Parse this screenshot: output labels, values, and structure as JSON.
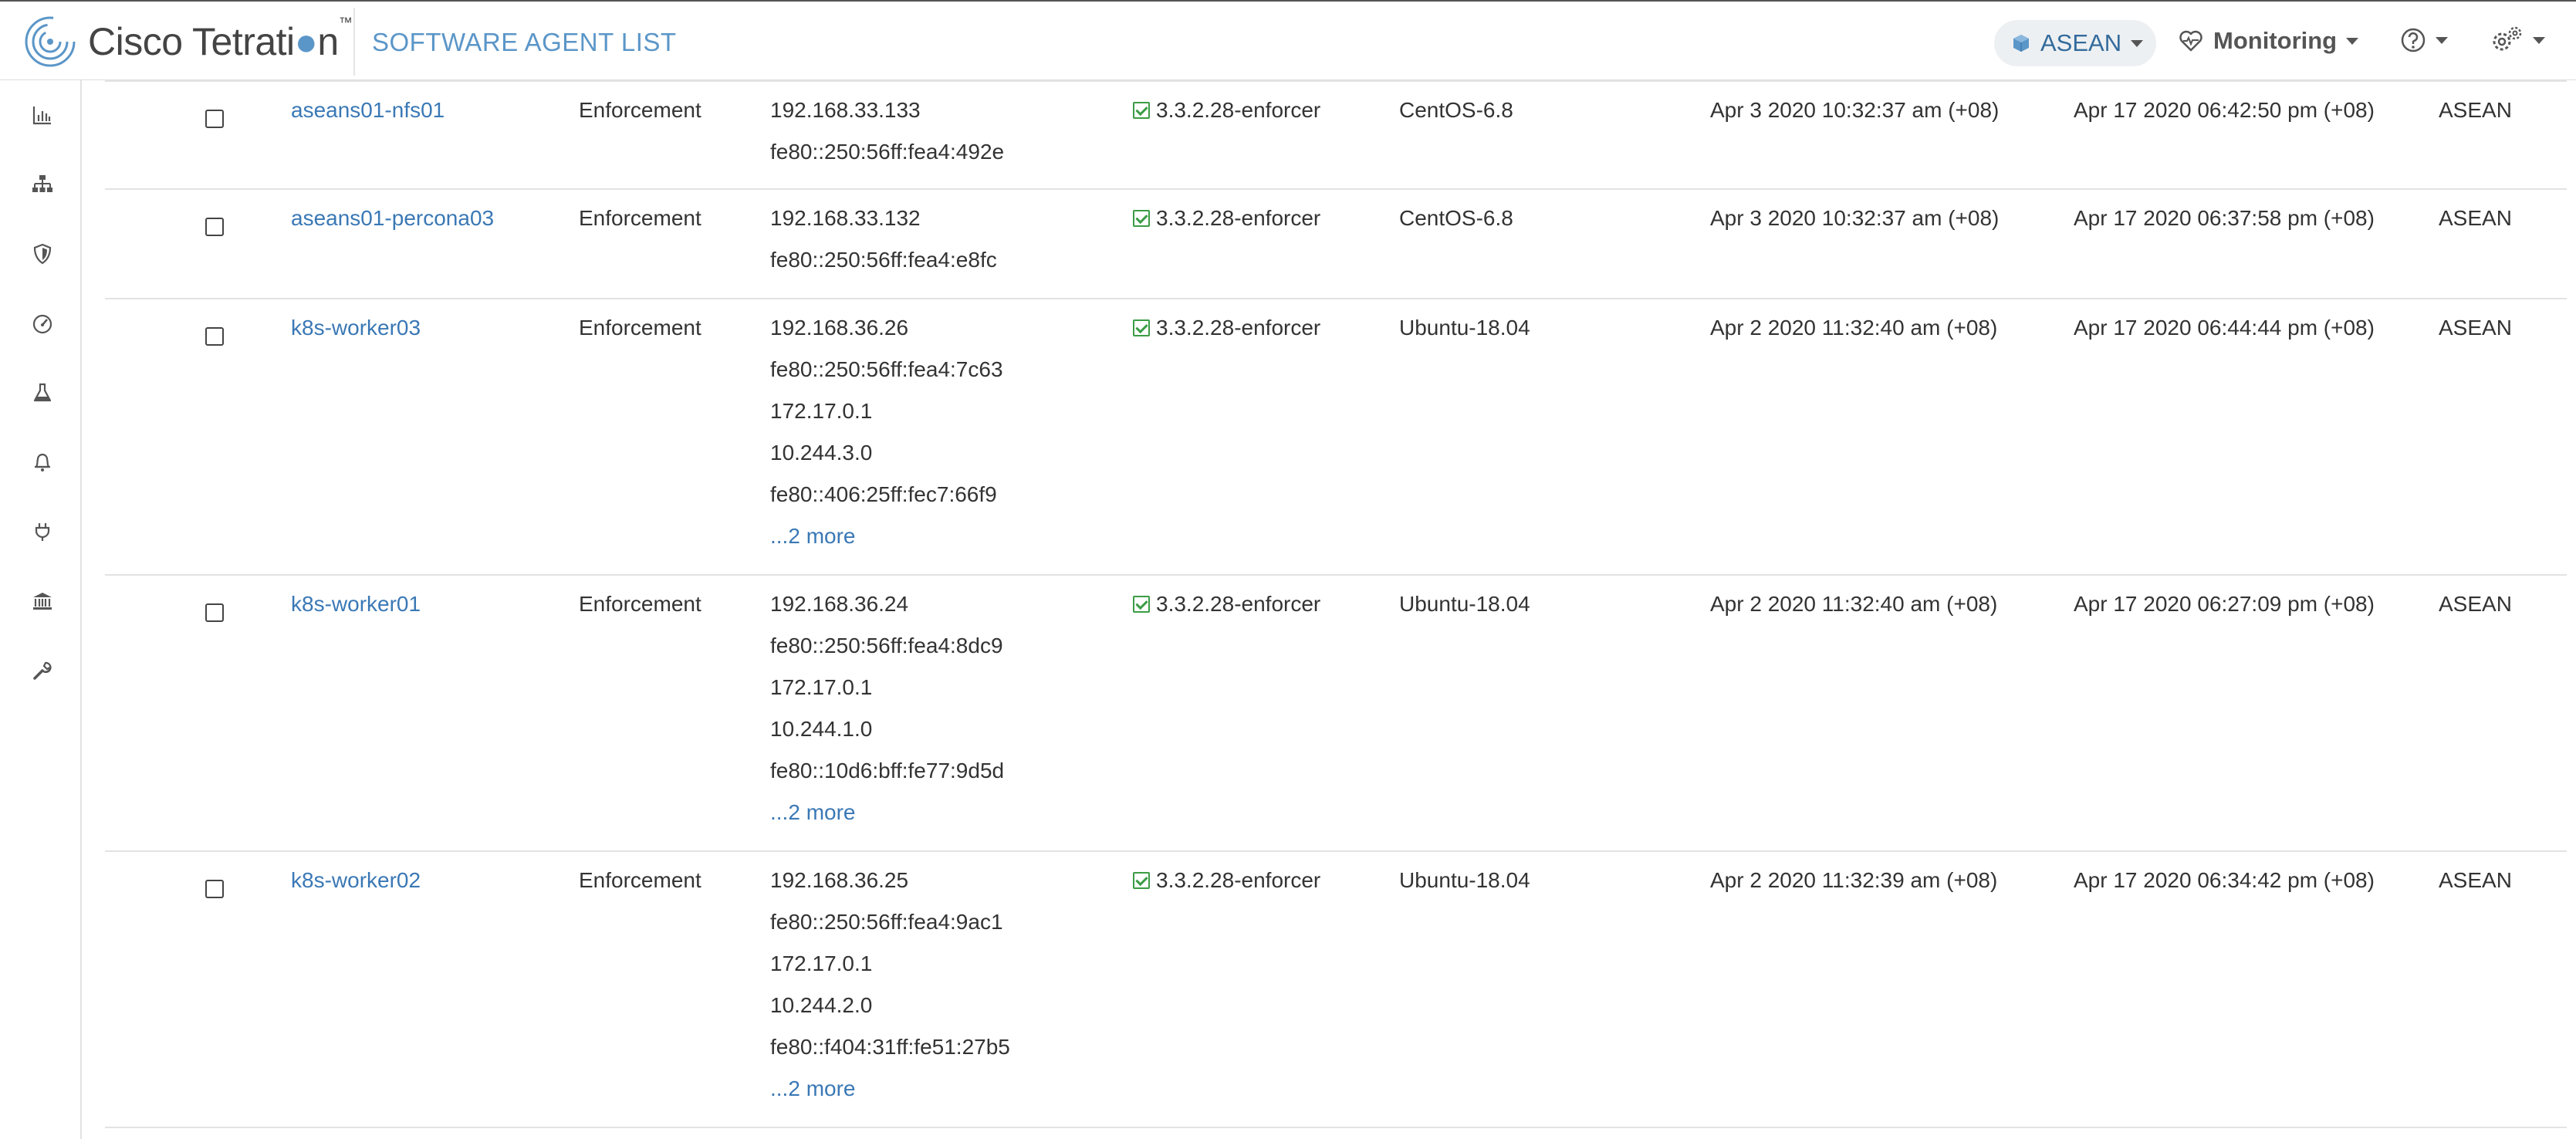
{
  "header": {
    "brand": "Cisco Tetrati",
    "brand_tail": "n",
    "brand_tm": "™",
    "page_title": "SOFTWARE AGENT LIST",
    "scope_selector": "ASEAN",
    "monitoring_label": "Monitoring"
  },
  "sidebar": {
    "icons": [
      "bar-chart-icon",
      "topology-icon",
      "shield-icon",
      "dashboard-gauge-icon",
      "flask-icon",
      "bell-icon",
      "plug-icon",
      "bank-icon",
      "wrench-icon"
    ]
  },
  "agents": [
    {
      "hostname": "aseans01-nfs01",
      "type": "Enforcement",
      "ips": [
        "192.168.33.133",
        "fe80::250:56ff:fea4:492e"
      ],
      "more": "",
      "version": "3.3.2.28-enforcer",
      "os": "CentOS-6.8",
      "created": "Apr 3 2020 10:32:37 am (+08)",
      "last_checkin": "Apr 17 2020 06:42:50 pm (+08)",
      "scope": "ASEAN"
    },
    {
      "hostname": "aseans01-percona03",
      "type": "Enforcement",
      "ips": [
        "192.168.33.132",
        "fe80::250:56ff:fea4:e8fc"
      ],
      "more": "",
      "version": "3.3.2.28-enforcer",
      "os": "CentOS-6.8",
      "created": "Apr 3 2020 10:32:37 am (+08)",
      "last_checkin": "Apr 17 2020 06:37:58 pm (+08)",
      "scope": "ASEAN"
    },
    {
      "hostname": "k8s-worker03",
      "type": "Enforcement",
      "ips": [
        "192.168.36.26",
        "fe80::250:56ff:fea4:7c63",
        "172.17.0.1",
        "10.244.3.0",
        "fe80::406:25ff:fec7:66f9"
      ],
      "more": "...2 more",
      "version": "3.3.2.28-enforcer",
      "os": "Ubuntu-18.04",
      "created": "Apr 2 2020 11:32:40 am (+08)",
      "last_checkin": "Apr 17 2020 06:44:44 pm (+08)",
      "scope": "ASEAN"
    },
    {
      "hostname": "k8s-worker01",
      "type": "Enforcement",
      "ips": [
        "192.168.36.24",
        "fe80::250:56ff:fea4:8dc9",
        "172.17.0.1",
        "10.244.1.0",
        "fe80::10d6:bff:fe77:9d5d"
      ],
      "more": "...2 more",
      "version": "3.3.2.28-enforcer",
      "os": "Ubuntu-18.04",
      "created": "Apr 2 2020 11:32:40 am (+08)",
      "last_checkin": "Apr 17 2020 06:27:09 pm (+08)",
      "scope": "ASEAN"
    },
    {
      "hostname": "k8s-worker02",
      "type": "Enforcement",
      "ips": [
        "192.168.36.25",
        "fe80::250:56ff:fea4:9ac1",
        "172.17.0.1",
        "10.244.2.0",
        "fe80::f404:31ff:fe51:27b5"
      ],
      "more": "...2 more",
      "version": "3.3.2.28-enforcer",
      "os": "Ubuntu-18.04",
      "created": "Apr 2 2020 11:32:39 am (+08)",
      "last_checkin": "Apr 17 2020 06:34:42 pm (+08)",
      "scope": "ASEAN"
    }
  ]
}
